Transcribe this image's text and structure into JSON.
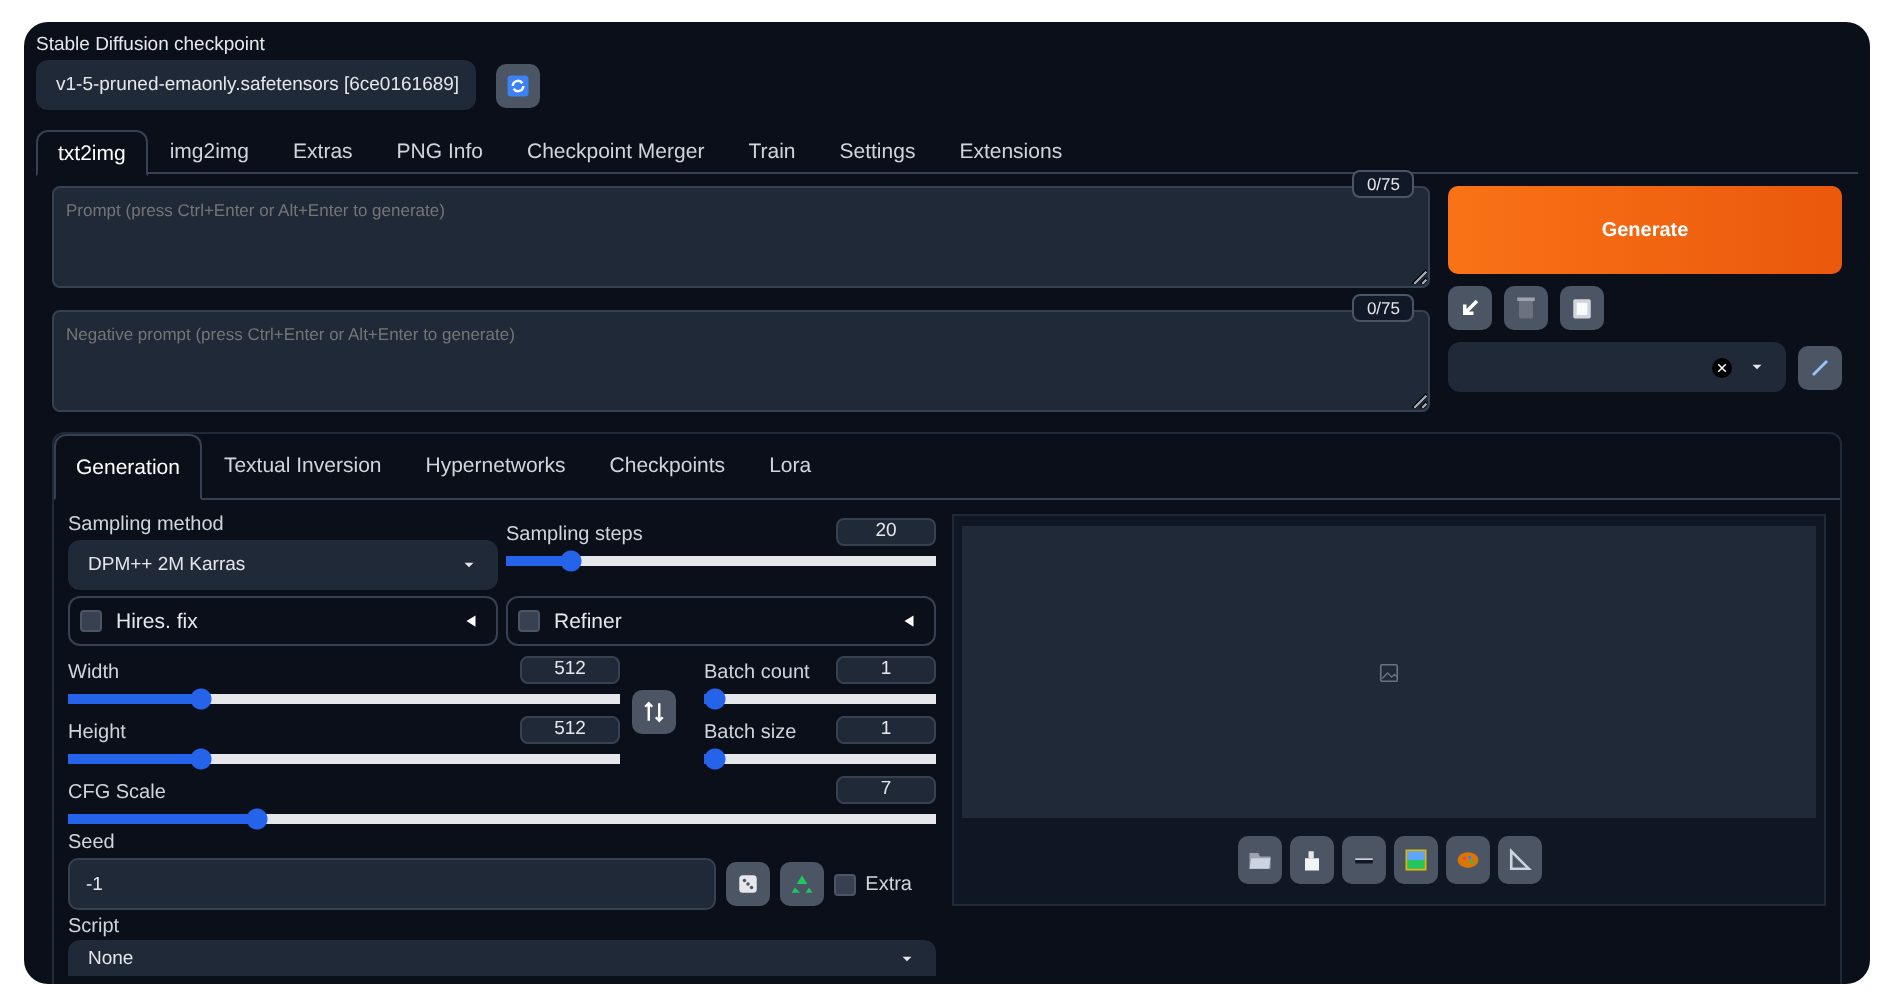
{
  "checkpoint": {
    "label": "Stable Diffusion checkpoint",
    "value": "v1-5-pruned-emaonly.safetensors [6ce0161689]"
  },
  "tabs": [
    {
      "label": "txt2img",
      "selected": true
    },
    {
      "label": "img2img",
      "selected": false
    },
    {
      "label": "Extras",
      "selected": false
    },
    {
      "label": "PNG Info",
      "selected": false
    },
    {
      "label": "Checkpoint Merger",
      "selected": false
    },
    {
      "label": "Train",
      "selected": false
    },
    {
      "label": "Settings",
      "selected": false
    },
    {
      "label": "Extensions",
      "selected": false
    }
  ],
  "prompt": {
    "placeholder": "Prompt (press Ctrl+Enter or Alt+Enter to generate)",
    "token_count": "0/75"
  },
  "negative_prompt": {
    "placeholder": "Negative prompt (press Ctrl+Enter or Alt+Enter to generate)",
    "token_count": "0/75"
  },
  "generate_button": "Generate",
  "subtabs": [
    {
      "label": "Generation",
      "selected": true
    },
    {
      "label": "Textual Inversion",
      "selected": false
    },
    {
      "label": "Hypernetworks",
      "selected": false
    },
    {
      "label": "Checkpoints",
      "selected": false
    },
    {
      "label": "Lora",
      "selected": false
    }
  ],
  "sampling_method": {
    "label": "Sampling method",
    "value": "DPM++ 2M Karras"
  },
  "sampling_steps": {
    "label": "Sampling steps",
    "value": "20",
    "level": 0.13
  },
  "accordions": [
    {
      "label": "Hires. fix",
      "checked": false
    },
    {
      "label": "Refiner",
      "checked": false
    }
  ],
  "width": {
    "label": "Width",
    "value": "512",
    "level": 0.23
  },
  "height": {
    "label": "Height",
    "value": "512",
    "level": 0.23
  },
  "batch_count": {
    "label": "Batch count",
    "value": "1",
    "level": 0
  },
  "batch_size": {
    "label": "Batch size",
    "value": "1",
    "level": 0
  },
  "cfg_scale": {
    "label": "CFG Scale",
    "value": "7",
    "level": 0.21
  },
  "seed": {
    "label": "Seed",
    "value": "-1"
  },
  "extra": {
    "label": "Extra",
    "checked": false
  },
  "script": {
    "label": "Script",
    "value": "None"
  }
}
